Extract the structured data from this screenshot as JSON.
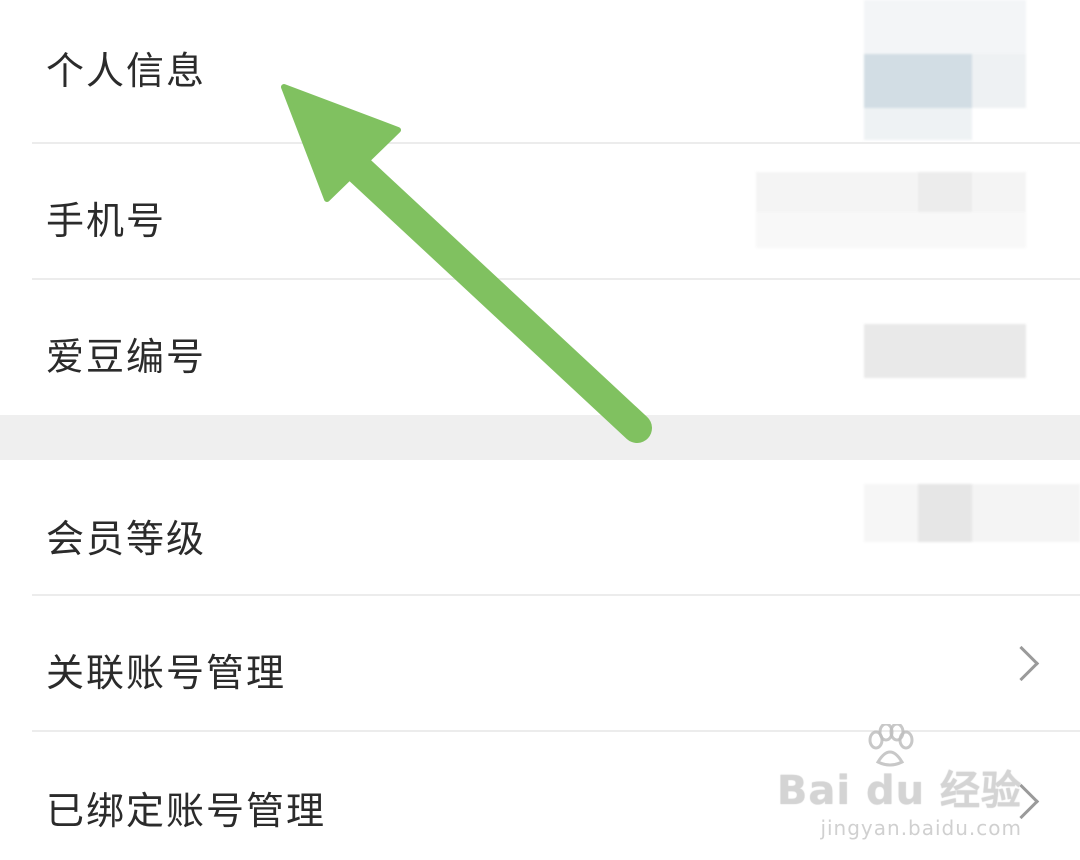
{
  "settings_list": {
    "items": [
      {
        "label": "个人信息"
      },
      {
        "label": "手机号"
      },
      {
        "label": "爱豆编号"
      },
      {
        "label": "会员等级"
      },
      {
        "label": "关联账号管理"
      },
      {
        "label": "已绑定账号管理"
      }
    ]
  },
  "annotation": {
    "arrow_color": "#80c160"
  },
  "watermark": {
    "brand": "Bai du 经验",
    "url": "jingyan.baidu.com"
  },
  "icons": {
    "chevron": "chevron-right-icon",
    "paw": "baidu-paw-icon"
  }
}
